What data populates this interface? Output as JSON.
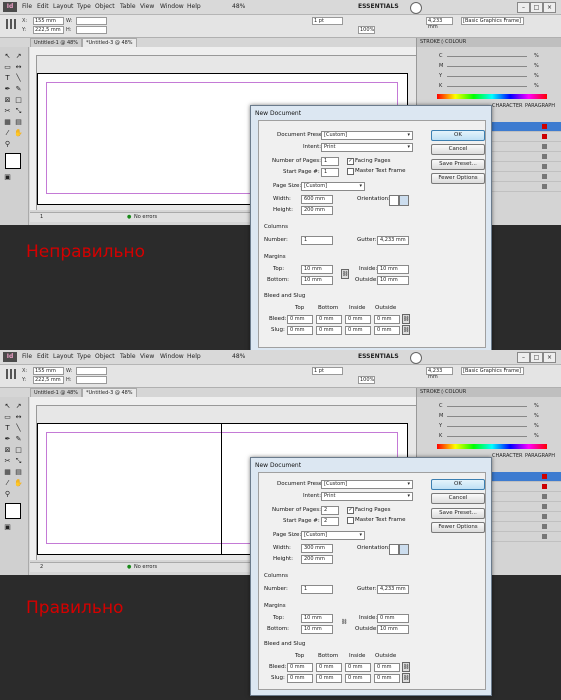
{
  "app": {
    "logo": "Id",
    "menu": [
      "File",
      "Edit",
      "Layout",
      "Type",
      "Object",
      "Table",
      "View",
      "Window",
      "Help"
    ],
    "zoom": "48%",
    "workspace": "ESSENTIALS",
    "window_controls": [
      "–",
      "□",
      "×"
    ]
  },
  "control_bar": {
    "x_label": "X:",
    "x_value": "155 mm",
    "y_label": "Y:",
    "y_value": "222,5 mm",
    "w_label": "W:",
    "h_label": "H:",
    "stroke_weight": "1 pt",
    "opacity": "100%",
    "measure": "4,233 mm",
    "frame_style": "[Basic Graphics Frame]"
  },
  "screens": [
    {
      "tabs": [
        "Untitled-1 @ 48%",
        "*Untitled-3 @ 48%"
      ],
      "status": {
        "page": "1",
        "errors": "No errors"
      },
      "dialog": {
        "title": "New Document",
        "preset_label": "Document Preset:",
        "preset_value": "[Custom]",
        "intent_label": "Intent:",
        "intent_value": "Print",
        "pages_label": "Number of Pages:",
        "pages_value": "1",
        "start_label": "Start Page #:",
        "start_value": "1",
        "facing_label": "Facing Pages",
        "facing_checked": "✓",
        "master_label": "Master Text Frame",
        "size_label": "Page Size:",
        "size_value": "[Custom]",
        "width_label": "Width:",
        "width_value": "600 mm",
        "height_label": "Height:",
        "height_value": "200 mm",
        "orientation_label": "Orientation:",
        "columns_heading": "Columns",
        "number_label": "Number:",
        "number_value": "1",
        "gutter_label": "Gutter:",
        "gutter_value": "4,233 mm",
        "margins_heading": "Margins",
        "top_label": "Top:",
        "top_value": "10 mm",
        "bottom_label": "Bottom:",
        "bottom_value": "10 mm",
        "inside_label": "Inside:",
        "inside_value": "10 mm",
        "outside_label": "Outside:",
        "outside_value": "10 mm",
        "bleed_heading": "Bleed and Slug",
        "bleed_cols": [
          "Top",
          "Bottom",
          "Inside",
          "Outside"
        ],
        "bleed_label": "Bleed:",
        "bleed_values": [
          "0 mm",
          "0 mm",
          "0 mm",
          "0 mm"
        ],
        "slug_label": "Slug:",
        "slug_values": [
          "0 mm",
          "0 mm",
          "0 mm",
          "0 mm"
        ],
        "ok": "OK",
        "cancel": "Cancel",
        "save_preset": "Save Preset...",
        "fewer_options": "Fewer Options"
      }
    },
    {
      "tabs": [
        "Untitled-1 @ 48%",
        "*Untitled-3 @ 48%"
      ],
      "status": {
        "page": "2",
        "errors": "No errors"
      },
      "dialog": {
        "title": "New Document",
        "preset_label": "Document Preset:",
        "preset_value": "[Custom]",
        "intent_label": "Intent:",
        "intent_value": "Print",
        "pages_label": "Number of Pages:",
        "pages_value": "2",
        "start_label": "Start Page #:",
        "start_value": "2",
        "facing_label": "Facing Pages",
        "facing_checked": "✓",
        "master_label": "Master Text Frame",
        "size_label": "Page Size:",
        "size_value": "[Custom]",
        "width_label": "Width:",
        "width_value": "300 mm",
        "height_label": "Height:",
        "height_value": "200 mm",
        "orientation_label": "Orientation:",
        "columns_heading": "Columns",
        "number_label": "Number:",
        "number_value": "1",
        "gutter_label": "Gutter:",
        "gutter_value": "4,233 mm",
        "margins_heading": "Margins",
        "top_label": "Top:",
        "top_value": "10 mm",
        "bottom_label": "Bottom:",
        "bottom_value": "10 mm",
        "inside_label": "Inside:",
        "inside_value": "0 mm",
        "outside_label": "Outside:",
        "outside_value": "10 mm",
        "bleed_heading": "Bleed and Slug",
        "bleed_cols": [
          "Top",
          "Bottom",
          "Inside",
          "Outside"
        ],
        "bleed_label": "Bleed:",
        "bleed_values": [
          "0 mm",
          "0 mm",
          "0 mm",
          "0 mm"
        ],
        "slug_label": "Slug:",
        "slug_values": [
          "0 mm",
          "0 mm",
          "0 mm",
          "0 mm"
        ],
        "ok": "OK",
        "cancel": "Cancel",
        "save_preset": "Save Preset...",
        "fewer_options": "Fewer Options"
      }
    }
  ],
  "panel": {
    "tabs": [
      "STROKE",
      "◊ COLOUR"
    ],
    "channels": [
      "C",
      "M",
      "Y",
      "K"
    ],
    "percent": "%",
    "bottom_tabs": [
      "CHARACTER",
      "PARAGRAPH"
    ]
  },
  "captions": {
    "wrong": "Неправильно",
    "right": "Правильно"
  },
  "colors": {
    "caption": "#d40000",
    "margin_guide": "#c47ad6",
    "ok_button": "#bfe0f5"
  }
}
